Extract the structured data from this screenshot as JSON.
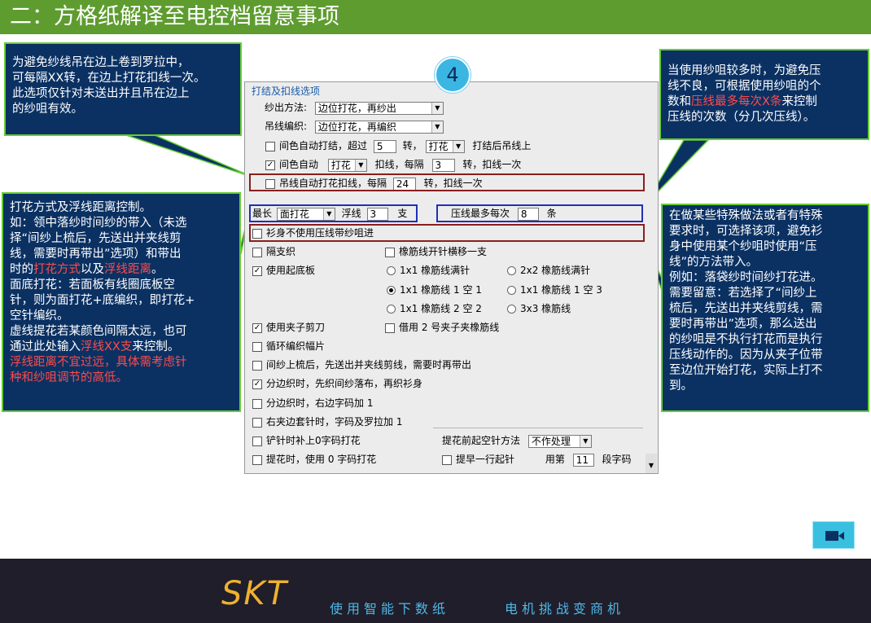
{
  "header": {
    "title": "二：方格纸解译至电控档留意事项"
  },
  "badge": "4",
  "callouts": {
    "top_left": [
      "为避免纱线吊在边上卷到罗拉中，",
      "可每隔XX转，在边上打花扣线一次。",
      "此选项仅针对未送出并且吊在边上",
      "的纱咀有效。"
    ],
    "left_mid": {
      "l1": "打花方式及浮线距离控制。",
      "l2": "如：领中落纱时间纱的带入（未选",
      "l3": "择“间纱上梳后，先送出并夹线剪",
      "l4": "线，需要时再带出”选项）和带出",
      "l5a": "时的",
      "l5b": "打花方式",
      "l5c": "以及",
      "l5d": "浮线距离",
      "l5e": "。",
      "l6": "面底打花：若面板有线圈底板空",
      "l7": "针，则为面打花+底编织，即打花+",
      "l8": "空针编织。",
      "l9": "虚线提花若某颜色间隔太远，也可",
      "l10a": "通过此处输入",
      "l10b": "浮线XX支",
      "l10c": "来控制。",
      "l11": "浮线距离不宜过远，具体需考虑针",
      "l12": "种和纱咀调节的高低。"
    },
    "top_right": {
      "l1": "当使用纱咀较多时，为避免压",
      "l2": "线不良，可根据使用纱咀的个",
      "l3a": "数和",
      "l3b": "压线最多每次X条",
      "l3c": "来控制",
      "l4": "压线的次数（分几次压线）。"
    },
    "right_mid": [
      "在做某些特殊做法或者有特殊",
      "要求时，可选择该项，避免衫",
      "身中使用某个纱咀时使用“压",
      "线”的方法带入。",
      "例如：落袋纱时间纱打花进。",
      "需要留意：若选择了“间纱上",
      "梳后，先送出并夹线剪线，需",
      "要时再带出”选项，那么送出",
      "的纱咀是不执行打花而是执行",
      "压线动作的。因为从夹子位带",
      "至边位开始打花，实际上打不",
      "到。"
    ]
  },
  "dialog": {
    "group_title": "打结及扣线选项",
    "yarn_out_label": "纱出方法:",
    "yarn_out_value": "边位打花，再纱出",
    "hang_label": "吊线编织:",
    "hang_value": "边位打花，再编织",
    "auto_knot": {
      "label": "间色自动打结，超过",
      "value": "5",
      "unit": "转，",
      "select": "打花",
      "suffix": "打结后吊线上"
    },
    "auto_color": {
      "label": "间色自动",
      "select": "打花",
      "mid": "扣线，每隔",
      "value": "3",
      "suffix": "转，扣线一次"
    },
    "hang_auto": {
      "label": "吊线自动打花扣线，每隔",
      "value": "24",
      "suffix": "转，扣线一次"
    },
    "longest": {
      "label": "最长",
      "select": "面打花",
      "float_label": "浮线",
      "float_value": "3",
      "unit": "支"
    },
    "press": {
      "label": "压线最多每次",
      "value": "8",
      "unit": "条"
    },
    "no_press": "衫身不使用压线带纱咀进",
    "gap_yarn": "隔支织",
    "rib_shift": "橡筋线开针横移一支",
    "use_base": "使用起底板",
    "radios": [
      "1x1 橡筋线满针",
      "2x2 橡筋线满针",
      "1x1 橡筋线 1 空 1",
      "1x1 橡筋线 1 空 3",
      "1x1 橡筋线 2 空 2",
      "3x3 橡筋线"
    ],
    "clip_cut": "使用夹子剪刀",
    "borrow_clip": "借用 2 号夹子夹橡筋线",
    "loop_width": "循环编织幅片",
    "gap_comb": "间纱上梳后，先送出并夹线剪线，需要时再带出",
    "split_knit": "分边织时，先织间纱落布，再织衫身",
    "split_right": "分边织时，右边字码加 1",
    "right_clip": "右夹边套针时，字码及罗拉加 1",
    "shovel": "铲针时补上0字码打花",
    "jacquard0": "提花时，使用 0 字码打花",
    "pre_empty_label": "提花前起空针方法",
    "pre_empty_value": "不作处理",
    "early_row": "提早一行起针",
    "use_label": "用第",
    "use_value": "11",
    "seg_label": "段字码"
  },
  "footer": {
    "logo": "SKT",
    "slogan1": "使用智能下数纸",
    "slogan2": "电机挑战变商机"
  }
}
